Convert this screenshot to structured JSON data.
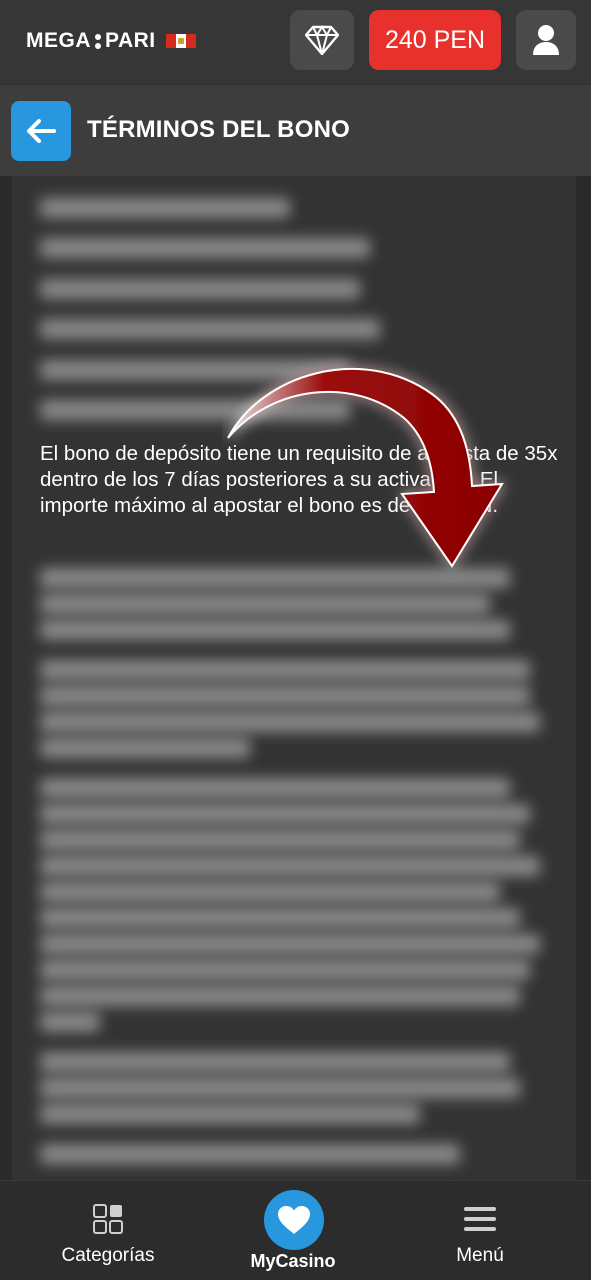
{
  "header": {
    "logo_text_left": "MEGA",
    "logo_text_right": "PARI",
    "balance": "240 PEN",
    "icons": {
      "vip": "diamond-icon",
      "account": "user-icon",
      "country_flag": "peru-flag-icon"
    },
    "colors": {
      "balance_bg": "#e8312c",
      "accent": "#2997dd"
    }
  },
  "titlebar": {
    "title": "TÉRMINOS DEL BONO",
    "back_icon": "arrow-left-icon"
  },
  "content": {
    "highlight_text": "El bono de depósito tiene un requisito de apuesta de 35x dentro de los 7 días posteriores a su activación. El importe máximo al apostar el bono es de 20. PEN."
  },
  "bottom_nav": {
    "items": [
      {
        "label": "Categorías",
        "icon": "grid-icon"
      },
      {
        "label": "MyCasino",
        "icon": "heart-icon"
      },
      {
        "label": "Menú",
        "icon": "hamburger-icon"
      }
    ]
  }
}
